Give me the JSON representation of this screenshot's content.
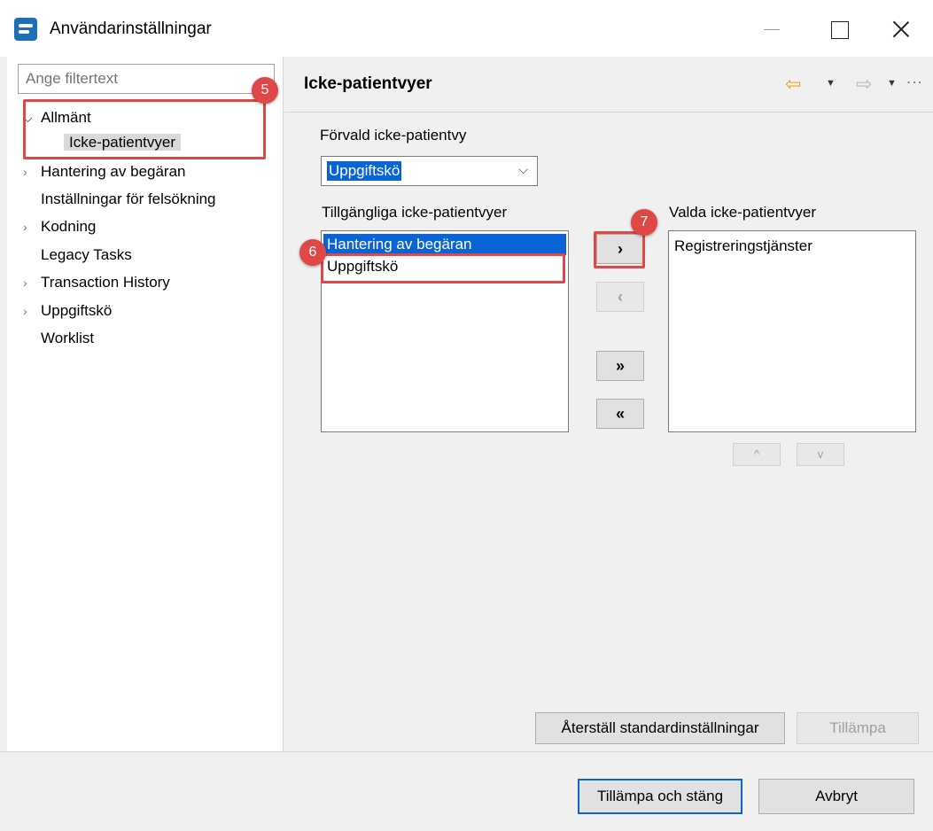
{
  "window": {
    "title": "Användarinställningar",
    "app_icon": "eclipse-app-icon"
  },
  "sidebar": {
    "filter_placeholder": "Ange filtertext",
    "items": [
      {
        "label": "Allmänt",
        "expanded": true
      },
      {
        "label": "Icke-patientvyer",
        "selected": true
      },
      {
        "label": "Hantering av begäran"
      },
      {
        "label": "Inställningar för felsökning"
      },
      {
        "label": "Kodning"
      },
      {
        "label": "Legacy Tasks"
      },
      {
        "label": "Transaction History"
      },
      {
        "label": "Uppgiftskö"
      },
      {
        "label": "Worklist"
      }
    ]
  },
  "main": {
    "title": "Icke-patientvyer",
    "default_view_label": "Förvald icke-patientvy",
    "default_view_value": "Uppgiftskö",
    "available_label": "Tillgängliga icke-patientvyer",
    "available_items": [
      "Hantering av begäran",
      "Uppgiftskö"
    ],
    "selected_label": "Valda icke-patientvyer",
    "selected_items": [
      "Registreringstjänster"
    ],
    "move_buttons": {
      "add": "›",
      "remove": "‹",
      "add_all": "»",
      "remove_all": "«"
    },
    "order_buttons": {
      "up": "^",
      "down": "v"
    },
    "restore_defaults": "Återställ standardinställningar",
    "apply": "Tillämpa"
  },
  "footer": {
    "apply_close": "Tillämpa och stäng",
    "cancel": "Avbryt"
  },
  "callouts": {
    "five": "5",
    "six": "6",
    "seven": "7",
    "color": "#e04848"
  },
  "colors": {
    "selection": "#0a64d6",
    "nav_back": "#e6a417"
  }
}
